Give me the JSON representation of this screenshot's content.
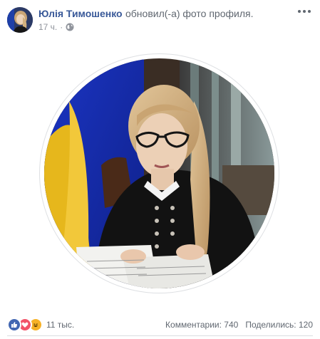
{
  "post": {
    "author": "Юлія Тимошенко",
    "action": "обновил(-а) фото профиля.",
    "timestamp": "17 ч.",
    "separator": "·",
    "privacy_icon": "globe-icon",
    "more_icon": "more-options-icon"
  },
  "reactions": {
    "icons": [
      "like-reaction-icon",
      "love-reaction-icon",
      "haha-reaction-icon"
    ],
    "count": "11 тыс."
  },
  "stats": {
    "comments": "Комментарии: 740",
    "shares": "Поделились: 120"
  },
  "colors": {
    "author_link": "#385898",
    "like": "#4267b2",
    "love": "#f25268",
    "haha": "#f7b125",
    "muted_text": "#90949c"
  }
}
